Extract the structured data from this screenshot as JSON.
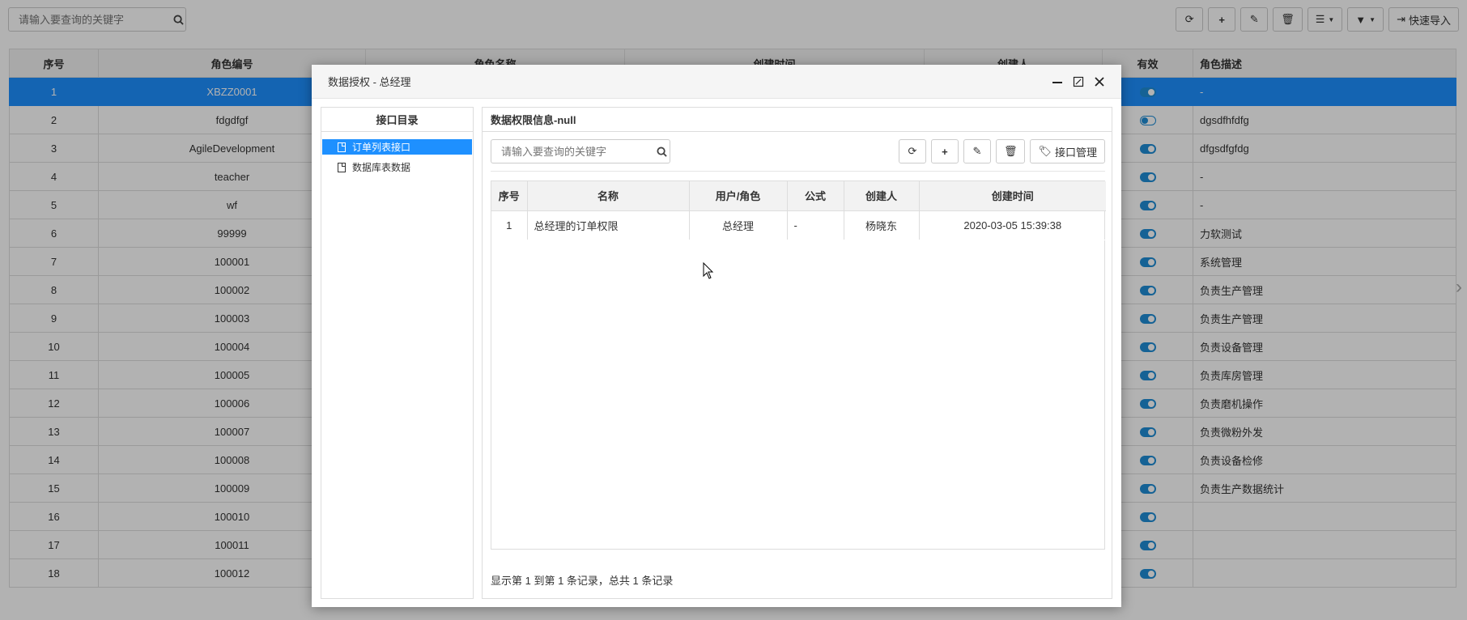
{
  "toolbar": {
    "search_placeholder": "请输入要查询的关键字",
    "import_label": "快速导入"
  },
  "table": {
    "columns": [
      "序号",
      "角色编号",
      "角色名称",
      "创建时间",
      "创建人",
      "有效",
      "角色描述"
    ],
    "rows": [
      {
        "index": "1",
        "code": "XBZZ0001",
        "active": true,
        "desc": "-"
      },
      {
        "index": "2",
        "code": "fdgdfgf",
        "active": false,
        "desc": "dgsdfhfdfg"
      },
      {
        "index": "3",
        "code": "AgileDevelopment",
        "active": true,
        "desc": "dfgsdfgfdg"
      },
      {
        "index": "4",
        "code": "teacher",
        "active": true,
        "desc": "-"
      },
      {
        "index": "5",
        "code": "wf",
        "active": true,
        "desc": "-"
      },
      {
        "index": "6",
        "code": "99999",
        "active": true,
        "desc": "力软测试"
      },
      {
        "index": "7",
        "code": "100001",
        "active": true,
        "desc": "系统管理"
      },
      {
        "index": "8",
        "code": "100002",
        "active": true,
        "desc": "负责生产管理"
      },
      {
        "index": "9",
        "code": "100003",
        "active": true,
        "desc": "负责生产管理"
      },
      {
        "index": "10",
        "code": "100004",
        "active": true,
        "desc": "负责设备管理"
      },
      {
        "index": "11",
        "code": "100005",
        "active": true,
        "desc": "负责库房管理"
      },
      {
        "index": "12",
        "code": "100006",
        "active": true,
        "desc": "负责磨机操作"
      },
      {
        "index": "13",
        "code": "100007",
        "active": true,
        "desc": "负责微粉外发"
      },
      {
        "index": "14",
        "code": "100008",
        "active": true,
        "desc": "负责设备检修"
      },
      {
        "index": "15",
        "code": "100009",
        "active": true,
        "desc": "负责生产数据统计"
      },
      {
        "index": "16",
        "code": "100010",
        "active": true,
        "desc": ""
      },
      {
        "index": "17",
        "code": "100011",
        "active": true,
        "desc": ""
      },
      {
        "index": "18",
        "code": "100012",
        "active": true,
        "desc": ""
      }
    ]
  },
  "modal": {
    "title": "数据授权 - 总经理",
    "left_panel": {
      "title": "接口目录",
      "items": [
        "订单列表接口",
        "数据库表数据"
      ]
    },
    "right_panel": {
      "title": "数据权限信息-null",
      "search_placeholder": "请输入要查询的关键字",
      "manage_label": "接口管理",
      "columns": [
        "序号",
        "名称",
        "用户/角色",
        "公式",
        "创建人",
        "创建时间"
      ],
      "rows": [
        {
          "index": "1",
          "name": "总经理的订单权限",
          "role": "总经理",
          "formula": "-",
          "creator": "杨晓东",
          "created": "2020-03-05 15:39:38"
        }
      ],
      "footer": "显示第 1 到第 1 条记录，总共 1 条记录"
    }
  },
  "colors": {
    "selected": "#1e90ff",
    "toggle": "#1f8dd6"
  }
}
